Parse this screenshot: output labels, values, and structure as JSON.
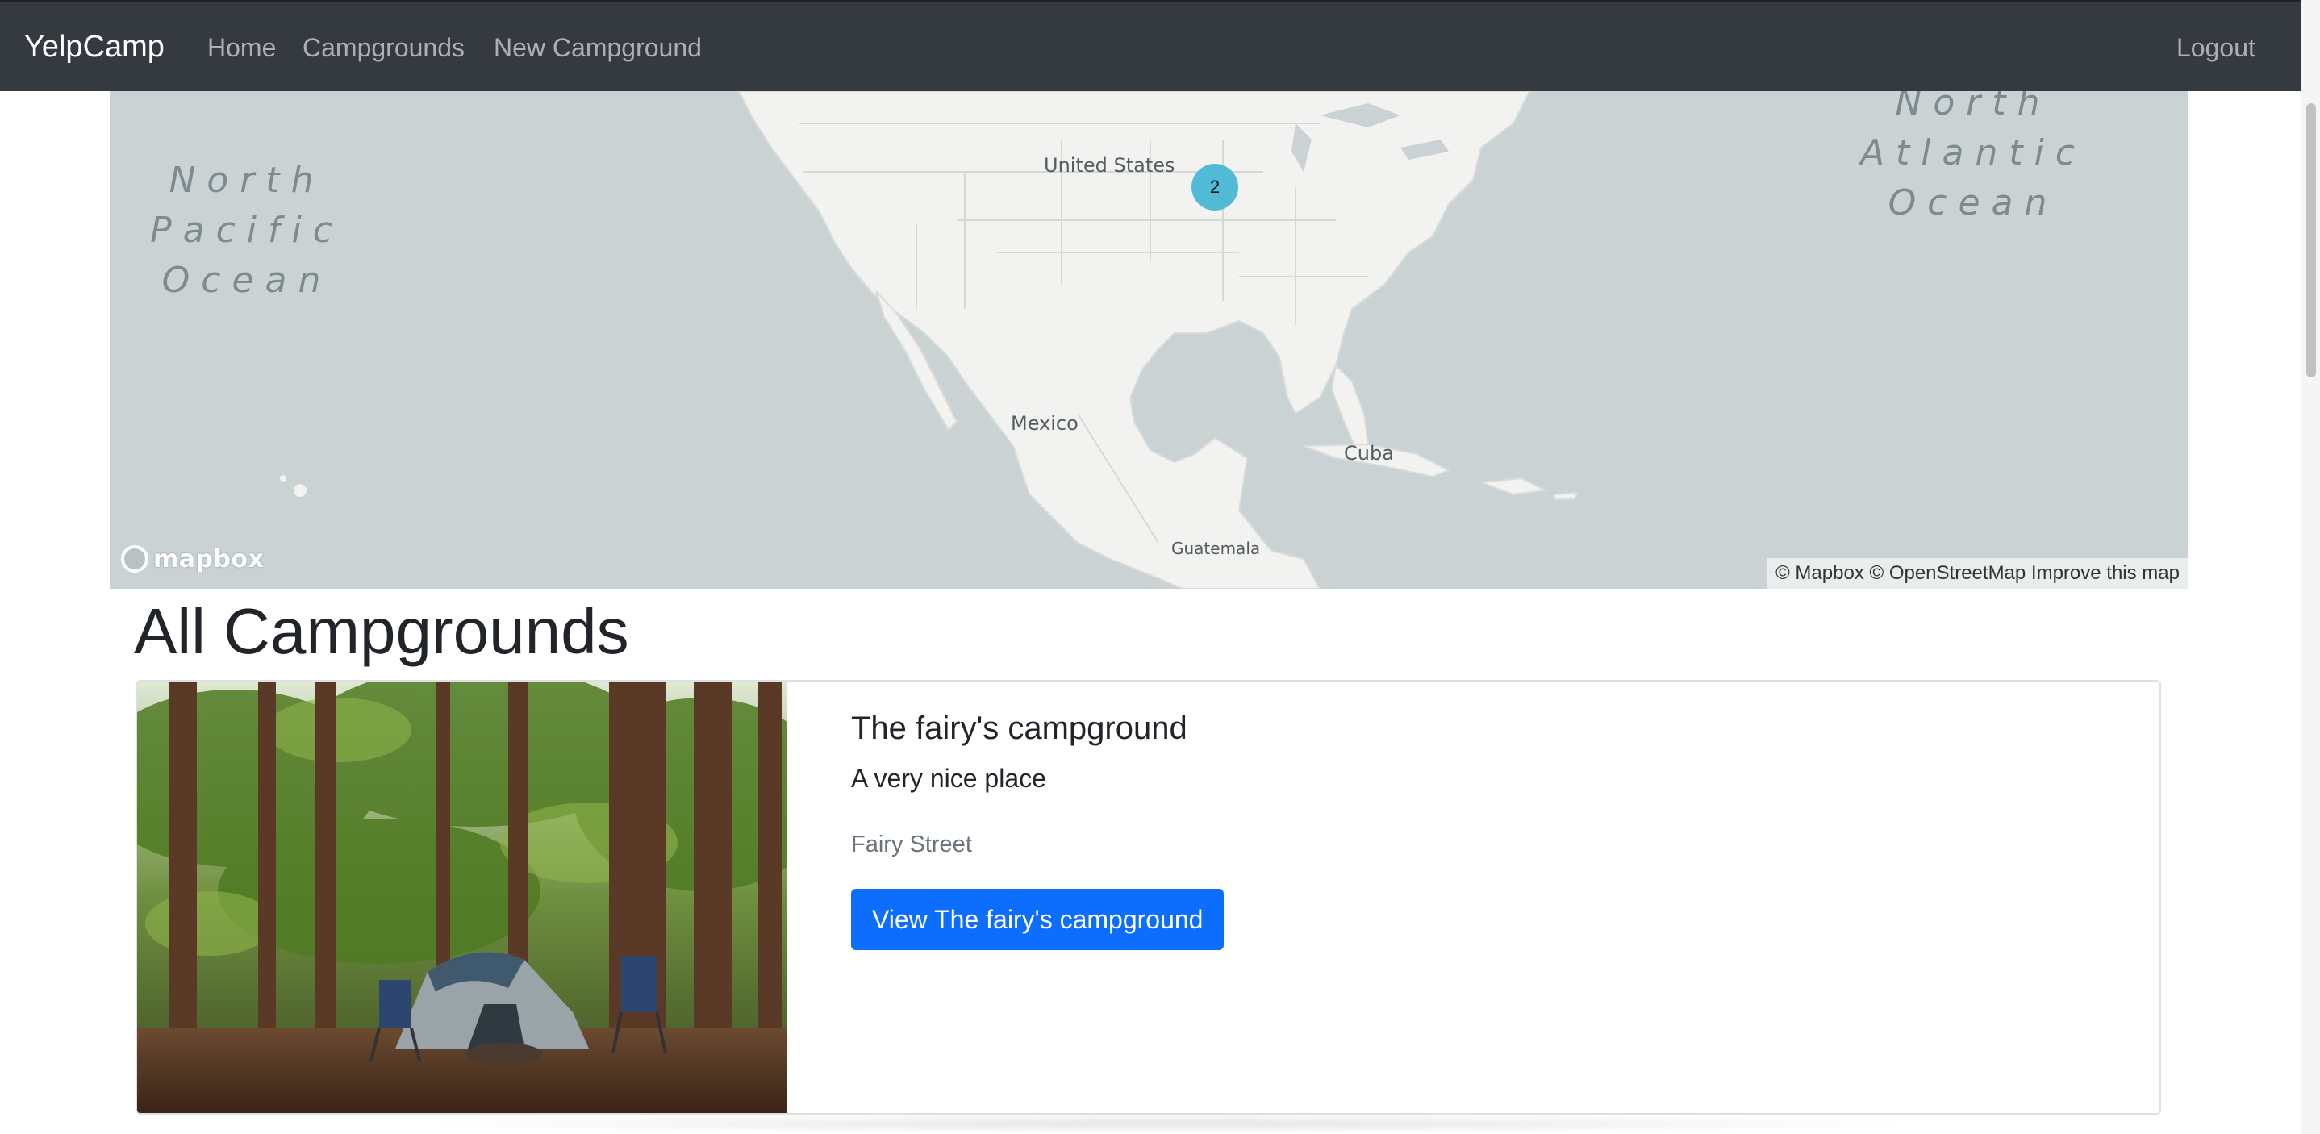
{
  "navbar": {
    "brand": "YelpCamp",
    "links": [
      "Home",
      "Campgrounds",
      "New Campground"
    ],
    "logout": "Logout",
    "background": "#343a40"
  },
  "map": {
    "ocean_labels": [
      "North\nPacific\nOcean",
      "North\nAtlantic\nOcean"
    ],
    "places": {
      "united_states": "United States",
      "mexico": "Mexico",
      "cuba": "Cuba",
      "guatemala": "Guatemala"
    },
    "cluster_count": "2",
    "cluster_color": "#51bbd6",
    "logo_text": "mapbox",
    "attribution": [
      "© Mapbox",
      "© OpenStreetMap",
      "Improve this map"
    ]
  },
  "page": {
    "title": "All Campgrounds"
  },
  "campgrounds": [
    {
      "title": "The fairy's campground",
      "description": "A very nice place",
      "location": "Fairy Street",
      "button_label": "View The fairy's campground",
      "button_color": "#0d6efd"
    }
  ]
}
